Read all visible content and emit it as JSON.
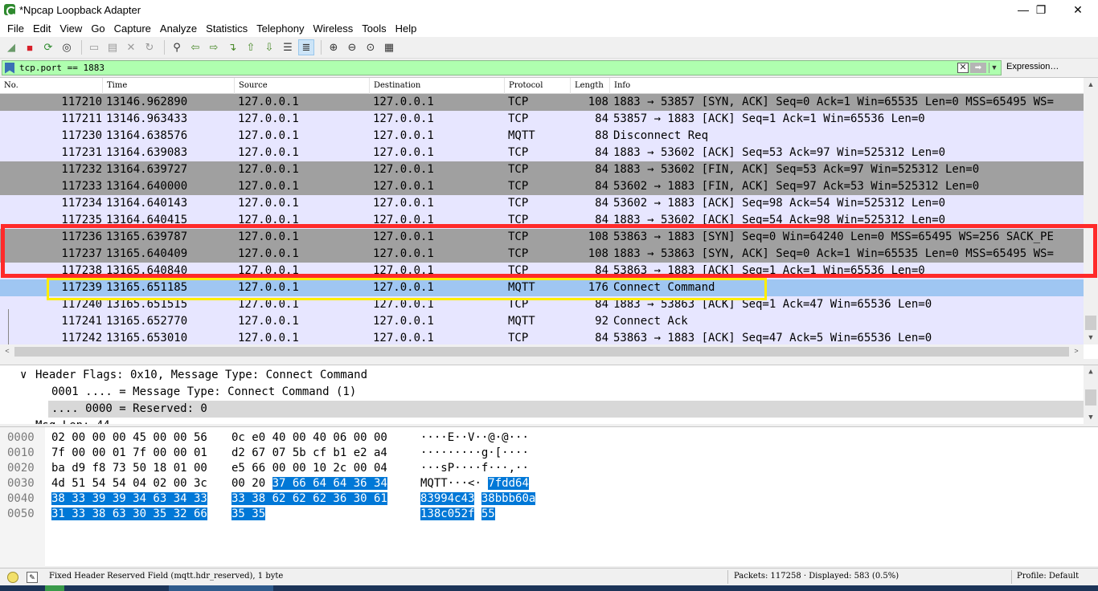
{
  "window": {
    "title": "*Npcap Loopback Adapter",
    "minimize_icon": "minimize-icon",
    "restore_icon": "restore-icon",
    "close_icon": "close-icon",
    "minimize_glyph": "—",
    "restore_glyph": "❐",
    "close_glyph": "✕"
  },
  "menu": [
    "File",
    "Edit",
    "View",
    "Go",
    "Capture",
    "Analyze",
    "Statistics",
    "Telephony",
    "Wireless",
    "Tools",
    "Help"
  ],
  "toolbar_glyphs": {
    "start": "◢",
    "stop": "■",
    "restart": "⟳",
    "options": "◎",
    "open": "▭",
    "save": "▤",
    "close": "✕",
    "reload": "↻",
    "find": "⚲",
    "back": "⇦",
    "forward": "⇨",
    "goto": "↴",
    "first": "⇧",
    "last": "⇩",
    "autoscroll": "☰",
    "colorize": "≣",
    "zoom_in": "⊕",
    "zoom_out": "⊖",
    "zoom_reset": "⊙",
    "resize": "▦"
  },
  "filter": {
    "text": "tcp.port == 1883",
    "clear_glyph": "✕",
    "apply_glyph": "➡",
    "dropdown_glyph": "▼",
    "expression_label": "Expression…"
  },
  "packet_list": {
    "columns": [
      "No.",
      "Time",
      "Source",
      "Destination",
      "Protocol",
      "Length",
      "Info"
    ],
    "rows": [
      {
        "no": "117210",
        "time": "13146.962890",
        "src": "127.0.0.1",
        "dst": "127.0.0.1",
        "proto": "TCP",
        "len": "108",
        "info": "1883 → 53857 [SYN, ACK] Seq=0 Ack=1 Win=65535 Len=0 MSS=65495 WS=",
        "style": "gray"
      },
      {
        "no": "117211",
        "time": "13146.963433",
        "src": "127.0.0.1",
        "dst": "127.0.0.1",
        "proto": "TCP",
        "len": "84",
        "info": "53857 → 1883 [ACK] Seq=1 Ack=1 Win=65536 Len=0",
        "style": "lav"
      },
      {
        "no": "117230",
        "time": "13164.638576",
        "src": "127.0.0.1",
        "dst": "127.0.0.1",
        "proto": "MQTT",
        "len": "88",
        "info": "Disconnect Req",
        "style": "lav"
      },
      {
        "no": "117231",
        "time": "13164.639083",
        "src": "127.0.0.1",
        "dst": "127.0.0.1",
        "proto": "TCP",
        "len": "84",
        "info": "1883 → 53602 [ACK] Seq=53 Ack=97 Win=525312 Len=0",
        "style": "lav"
      },
      {
        "no": "117232",
        "time": "13164.639727",
        "src": "127.0.0.1",
        "dst": "127.0.0.1",
        "proto": "TCP",
        "len": "84",
        "info": "1883 → 53602 [FIN, ACK] Seq=53 Ack=97 Win=525312 Len=0",
        "style": "gray"
      },
      {
        "no": "117233",
        "time": "13164.640000",
        "src": "127.0.0.1",
        "dst": "127.0.0.1",
        "proto": "TCP",
        "len": "84",
        "info": "53602 → 1883 [FIN, ACK] Seq=97 Ack=53 Win=525312 Len=0",
        "style": "gray"
      },
      {
        "no": "117234",
        "time": "13164.640143",
        "src": "127.0.0.1",
        "dst": "127.0.0.1",
        "proto": "TCP",
        "len": "84",
        "info": "53602 → 1883 [ACK] Seq=98 Ack=54 Win=525312 Len=0",
        "style": "lav"
      },
      {
        "no": "117235",
        "time": "13164.640415",
        "src": "127.0.0.1",
        "dst": "127.0.0.1",
        "proto": "TCP",
        "len": "84",
        "info": "1883 → 53602 [ACK] Seq=54 Ack=98 Win=525312 Len=0",
        "style": "lav"
      },
      {
        "no": "117236",
        "time": "13165.639787",
        "src": "127.0.0.1",
        "dst": "127.0.0.1",
        "proto": "TCP",
        "len": "108",
        "info": "53863 → 1883 [SYN] Seq=0 Win=64240 Len=0 MSS=65495 WS=256 SACK_PE",
        "style": "gray"
      },
      {
        "no": "117237",
        "time": "13165.640409",
        "src": "127.0.0.1",
        "dst": "127.0.0.1",
        "proto": "TCP",
        "len": "108",
        "info": "1883 → 53863 [SYN, ACK] Seq=0 Ack=1 Win=65535 Len=0 MSS=65495 WS=",
        "style": "gray"
      },
      {
        "no": "117238",
        "time": "13165.640840",
        "src": "127.0.0.1",
        "dst": "127.0.0.1",
        "proto": "TCP",
        "len": "84",
        "info": "53863 → 1883 [ACK] Seq=1 Ack=1 Win=65536 Len=0",
        "style": "lav"
      },
      {
        "no": "117239",
        "time": "13165.651185",
        "src": "127.0.0.1",
        "dst": "127.0.0.1",
        "proto": "MQTT",
        "len": "176",
        "info": "Connect Command",
        "style": "sel"
      },
      {
        "no": "117240",
        "time": "13165.651515",
        "src": "127.0.0.1",
        "dst": "127.0.0.1",
        "proto": "TCP",
        "len": "84",
        "info": "1883 → 53863 [ACK] Seq=1 Ack=47 Win=65536 Len=0",
        "style": "lav"
      },
      {
        "no": "117241",
        "time": "13165.652770",
        "src": "127.0.0.1",
        "dst": "127.0.0.1",
        "proto": "MQTT",
        "len": "92",
        "info": "Connect Ack",
        "style": "lav"
      },
      {
        "no": "117242",
        "time": "13165.653010",
        "src": "127.0.0.1",
        "dst": "127.0.0.1",
        "proto": "TCP",
        "len": "84",
        "info": "53863 → 1883 [ACK] Seq=47 Ack=5 Win=65536 Len=0",
        "style": "lav"
      }
    ],
    "scroll_up_glyph": "▲",
    "scroll_down_glyph": "▼",
    "scroll_left_glyph": "<",
    "scroll_right_glyph": ">"
  },
  "detail": {
    "expander_glyph": "∨",
    "lines": [
      "Header Flags: 0x10, Message Type: Connect Command",
      "0001 .... = Message Type: Connect Command (1)",
      ".... 0000 = Reserved: 0",
      "Msg Len: 44"
    ]
  },
  "hex": {
    "rows": [
      {
        "offset": "0000",
        "b1": "02 00 00 00 45 00 00 56",
        "b2": "0c e0 40 00 40 06 00 00",
        "b2_hl": "",
        "a1": "····E··V",
        "a2": "··@·@···",
        "a2_hl": ""
      },
      {
        "offset": "0010",
        "b1": "7f 00 00 01 7f 00 00 01",
        "b2": "d2 67 07 5b cf b1 e2 a4",
        "b2_hl": "",
        "a1": "········",
        "a2": "·g·[····",
        "a2_hl": ""
      },
      {
        "offset": "0020",
        "b1": "ba d9 f8 73 50 18 01 00",
        "b2": "e5 66 00 00 10 2c 00 04",
        "b2_hl": "",
        "a1": "···sP···",
        "a2": "·f···,··",
        "a2_hl": ""
      },
      {
        "offset": "0030",
        "b1": "4d 51 54 54 04 02 00 3c",
        "b2": "00 20 ",
        "b2_hl": "37 66 64 64 36 34",
        "a1": "MQTT···<",
        "a2": "· ",
        "a2_hl": "7fdd64"
      },
      {
        "offset": "0040",
        "b1_hl": "38 33 39 39 34 63 34 33",
        "b2_hl": "33 38 62 62 62 36 30 61",
        "a1_hl": "83994c43",
        "a2_hl": "38bbb60a"
      },
      {
        "offset": "0050",
        "b1_hl": "31 33 38 63 30 35 32 66",
        "b2_hl": "35 35",
        "a1_hl": "138c052f",
        "a2_hl": "55"
      }
    ]
  },
  "status": {
    "field": "Fixed Header Reserved Field (mqtt.hdr_reserved), 1 byte",
    "packets": "Packets: 117258 · Displayed: 583 (0.5%)",
    "profile": "Profile: Default"
  }
}
